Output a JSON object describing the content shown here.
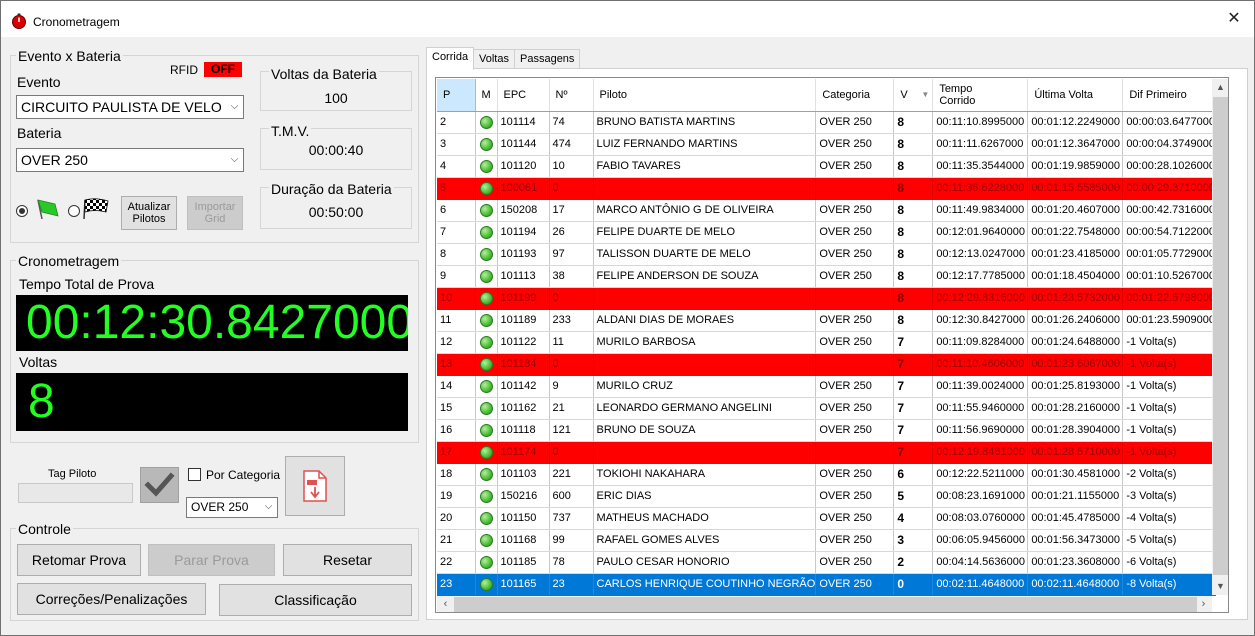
{
  "window": {
    "title": "Cronometragem",
    "close_glyph": "✕"
  },
  "evento_bateria": {
    "group_label": "Evento x Bateria",
    "rfid_label": "RFID",
    "rfid_status": "OFF",
    "evento_label": "Evento",
    "evento_value": "CIRCUITO PAULISTA DE VELO",
    "bateria_label": "Bateria",
    "bateria_value": "OVER 250",
    "atualizar_label": "Atualizar Pilotos",
    "importar_label": "Importar Grid"
  },
  "stats": {
    "voltas_bateria_label": "Voltas da Bateria",
    "voltas_bateria_value": "100",
    "tmv_label": "T.M.V.",
    "tmv_value": "00:00:40",
    "duracao_label": "Duração da Bateria",
    "duracao_value": "00:50:00"
  },
  "cronometragem": {
    "group_label": "Cronometragem",
    "tempo_label": "Tempo Total de Prova",
    "tempo_value": "00:12:30.8427000",
    "voltas_label": "Voltas",
    "voltas_value": "8"
  },
  "tag": {
    "tag_label": "Tag Piloto",
    "tag_value": "",
    "por_categoria_label": "Por Categoria",
    "categoria_value": "OVER 250"
  },
  "controle": {
    "group_label": "Controle",
    "retomar": "Retomar Prova",
    "parar": "Parar Prova",
    "resetar": "Resetar",
    "correcoes": "Correções/Penalizações",
    "classificacao": "Classificação"
  },
  "tabs": [
    "Corrida",
    "Voltas",
    "Passagens"
  ],
  "grid": {
    "columns": [
      "P",
      "M",
      "EPC",
      "Nº",
      "Piloto",
      "Categoria",
      "V",
      "Tempo Corrido",
      "Última Volta",
      "Dif Primeiro"
    ],
    "rows": [
      {
        "p": "2",
        "epc": "101114",
        "num": "74",
        "piloto": "BRUNO BATISTA MARTINS",
        "cat": "OVER 250",
        "v": "8",
        "tempo": "00:11:10.8995000",
        "ultima": "00:01:12.2249000",
        "dif": "00:00:03.6477000",
        "style": "normal"
      },
      {
        "p": "3",
        "epc": "101144",
        "num": "474",
        "piloto": "LUIZ FERNANDO MARTINS",
        "cat": "OVER 250",
        "v": "8",
        "tempo": "00:11:11.6267000",
        "ultima": "00:01:12.3647000",
        "dif": "00:00:04.3749000",
        "style": "normal"
      },
      {
        "p": "4",
        "epc": "101120",
        "num": "10",
        "piloto": "FABIO TAVARES",
        "cat": "OVER 250",
        "v": "8",
        "tempo": "00:11:35.3544000",
        "ultima": "00:01:19.9859000",
        "dif": "00:00:28.1026000",
        "style": "normal"
      },
      {
        "p": "5",
        "epc": "100061",
        "num": "0",
        "piloto": "",
        "cat": "",
        "v": "8",
        "tempo": "00:11:36.6228000",
        "ultima": "00:01:15.5585000",
        "dif": "00:00:29.3710000",
        "style": "red"
      },
      {
        "p": "6",
        "epc": "150208",
        "num": "17",
        "piloto": "MARCO ANTÔNIO G DE OLIVEIRA",
        "cat": "OVER 250",
        "v": "8",
        "tempo": "00:11:49.9834000",
        "ultima": "00:01:20.4607000",
        "dif": "00:00:42.7316000",
        "style": "normal"
      },
      {
        "p": "7",
        "epc": "101194",
        "num": "26",
        "piloto": "FELIPE DUARTE DE MELO",
        "cat": "OVER 250",
        "v": "8",
        "tempo": "00:12:01.9640000",
        "ultima": "00:01:22.7548000",
        "dif": "00:00:54.7122000",
        "style": "normal"
      },
      {
        "p": "8",
        "epc": "101193",
        "num": "97",
        "piloto": "TALISSON DUARTE DE MELO",
        "cat": "OVER 250",
        "v": "8",
        "tempo": "00:12:13.0247000",
        "ultima": "00:01:23.4185000",
        "dif": "00:01:05.7729000",
        "style": "normal"
      },
      {
        "p": "9",
        "epc": "101113",
        "num": "38",
        "piloto": "FELIPE ANDERSON DE SOUZA",
        "cat": "OVER 250",
        "v": "8",
        "tempo": "00:12:17.7785000",
        "ultima": "00:01:18.4504000",
        "dif": "00:01:10.5267000",
        "style": "normal"
      },
      {
        "p": "10",
        "epc": "101199",
        "num": "0",
        "piloto": "",
        "cat": "",
        "v": "8",
        "tempo": "00:12:29.8316000",
        "ultima": "00:01:23.5732000",
        "dif": "00:01:22.5798000",
        "style": "red"
      },
      {
        "p": "11",
        "epc": "101189",
        "num": "233",
        "piloto": "ALDANI DIAS DE MORAES",
        "cat": "OVER 250",
        "v": "8",
        "tempo": "00:12:30.8427000",
        "ultima": "00:01:26.2406000",
        "dif": "00:01:23.5909000",
        "style": "normal"
      },
      {
        "p": "12",
        "epc": "101122",
        "num": "11",
        "piloto": "MURILO BARBOSA",
        "cat": "OVER 250",
        "v": "7",
        "tempo": "00:11:09.8284000",
        "ultima": "00:01:24.6488000",
        "dif": "-1 Volta(s)",
        "style": "normal"
      },
      {
        "p": "13",
        "epc": "101184",
        "num": "0",
        "piloto": "",
        "cat": "",
        "v": "7",
        "tempo": "00:11:10.4606000",
        "ultima": "00:01:23.6067000",
        "dif": "-1 Volta(s)",
        "style": "red"
      },
      {
        "p": "14",
        "epc": "101142",
        "num": "9",
        "piloto": "MURILO CRUZ",
        "cat": "OVER 250",
        "v": "7",
        "tempo": "00:11:39.0024000",
        "ultima": "00:01:25.8193000",
        "dif": "-1 Volta(s)",
        "style": "normal"
      },
      {
        "p": "15",
        "epc": "101162",
        "num": "21",
        "piloto": "LEONARDO GERMANO ANGELINI",
        "cat": "OVER 250",
        "v": "7",
        "tempo": "00:11:55.9460000",
        "ultima": "00:01:28.2160000",
        "dif": "-1 Volta(s)",
        "style": "normal"
      },
      {
        "p": "16",
        "epc": "101118",
        "num": "121",
        "piloto": "BRUNO DE SOUZA",
        "cat": "OVER 250",
        "v": "7",
        "tempo": "00:11:56.9690000",
        "ultima": "00:01:28.3904000",
        "dif": "-1 Volta(s)",
        "style": "normal"
      },
      {
        "p": "17",
        "epc": "101174",
        "num": "0",
        "piloto": "",
        "cat": "",
        "v": "7",
        "tempo": "00:12:19.8481000",
        "ultima": "00:01:28.5710000",
        "dif": "-1 Volta(s)",
        "style": "red"
      },
      {
        "p": "18",
        "epc": "101103",
        "num": "221",
        "piloto": "TOKIOHI NAKAHARA",
        "cat": "OVER 250",
        "v": "6",
        "tempo": "00:12:22.5211000",
        "ultima": "00:01:30.4581000",
        "dif": "-2 Volta(s)",
        "style": "normal"
      },
      {
        "p": "19",
        "epc": "150216",
        "num": "600",
        "piloto": "ERIC DIAS",
        "cat": "OVER 250",
        "v": "5",
        "tempo": "00:08:23.1691000",
        "ultima": "00:01:21.1155000",
        "dif": "-3 Volta(s)",
        "style": "normal"
      },
      {
        "p": "20",
        "epc": "101150",
        "num": "737",
        "piloto": "MATHEUS MACHADO",
        "cat": "OVER 250",
        "v": "4",
        "tempo": "00:08:03.0760000",
        "ultima": "00:01:45.4785000",
        "dif": "-4 Volta(s)",
        "style": "normal"
      },
      {
        "p": "21",
        "epc": "101168",
        "num": "99",
        "piloto": "RAFAEL GOMES ALVES",
        "cat": "OVER 250",
        "v": "3",
        "tempo": "00:06:05.9456000",
        "ultima": "00:01:56.3473000",
        "dif": "-5 Volta(s)",
        "style": "normal"
      },
      {
        "p": "22",
        "epc": "101185",
        "num": "78",
        "piloto": "PAULO CESAR HONORIO",
        "cat": "OVER 250",
        "v": "2",
        "tempo": "00:04:14.5636000",
        "ultima": "00:01:23.3608000",
        "dif": "-6 Volta(s)",
        "style": "normal"
      },
      {
        "p": "23",
        "epc": "101165",
        "num": "23",
        "piloto": "CARLOS HENRIQUE COUTINHO NEGRÃO",
        "cat": "OVER 250",
        "v": "0",
        "tempo": "00:02:11.4648000",
        "ultima": "00:02:11.4648000",
        "dif": "-8 Volta(s)",
        "style": "sel"
      }
    ]
  },
  "colors": {
    "led_green": "#22ff22",
    "red_row": "#ff0000",
    "selected_row": "#0078d7",
    "rfid_off_bg": "#ff0000"
  },
  "icons": [
    "app-stopwatch-icon",
    "green-flag-icon",
    "checkered-flag-icon",
    "checkmark-icon",
    "pdf-export-icon",
    "close-icon",
    "sort-arrow-icon"
  ]
}
